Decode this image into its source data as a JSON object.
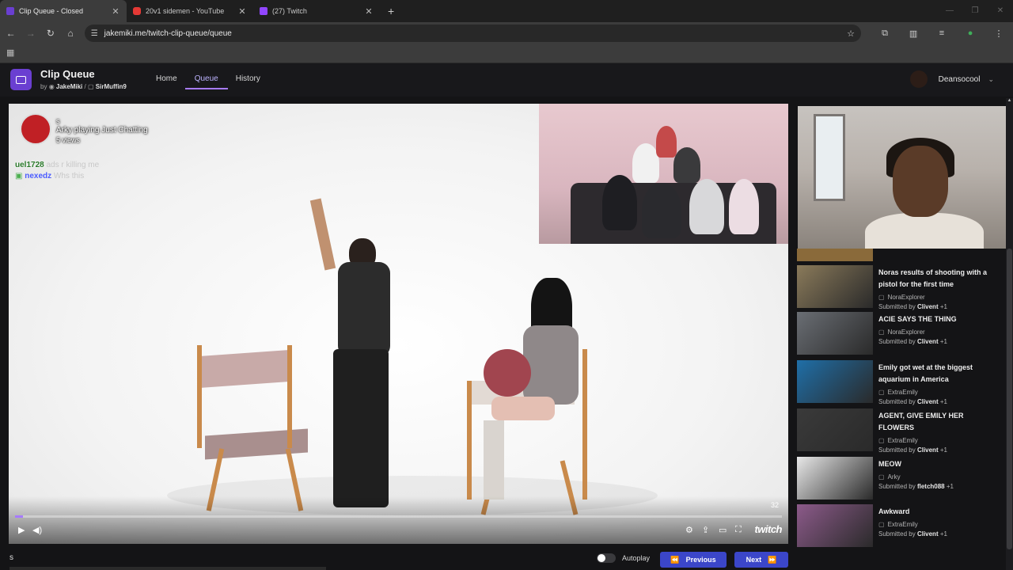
{
  "browser": {
    "tabs": [
      {
        "title": "Clip Queue - Closed",
        "color": "#6a3fd1",
        "active": true
      },
      {
        "title": "20v1 sidemen - YouTube",
        "color": "#e53935",
        "active": false
      },
      {
        "title": "(27) Twitch",
        "color": "#9146ff",
        "active": false
      }
    ],
    "new_tab": "+",
    "url": "jakemiki.me/twitch-clip-queue/queue"
  },
  "app": {
    "name": "Clip Queue",
    "by": "by",
    "author1": "JakeMiki",
    "separator": "/",
    "author2": "SirMuffin9",
    "nav": [
      "Home",
      "Queue",
      "History"
    ],
    "active_nav": "Queue",
    "username": "Deansocool"
  },
  "player": {
    "clip_title": "s",
    "broadcaster": "Arky",
    "game_prefix": "playing",
    "game": "Just Chatting",
    "views": "5 views",
    "time": "32",
    "progress": 0.01,
    "brand": "twitch",
    "chat": [
      {
        "user": "uel1728",
        "msg": "ads r killing me"
      },
      {
        "user": "nexedz",
        "msg": "Whs this"
      }
    ]
  },
  "queue": [
    {
      "title": "Noras results of shooting with a pistol for the first time",
      "channel": "NoraExplorer",
      "submitted_by": "Submitted by",
      "submitter": "Clivent",
      "extra": "+1",
      "thumb": "#8a7a5a"
    },
    {
      "title": "ACIE SAYS THE THING",
      "channel": "NoraExplorer",
      "submitted_by": "Submitted by",
      "submitter": "Clivent",
      "extra": "+1",
      "thumb": "#6a6e74"
    },
    {
      "title": "Emily got wet at the biggest aquarium in America",
      "channel": "ExtraEmily",
      "submitted_by": "Submitted by",
      "submitter": "Clivent",
      "extra": "+1",
      "thumb": "#1f6fa8"
    },
    {
      "title": "AGENT, GIVE EMILY HER FLOWERS",
      "channel": "ExtraEmily",
      "submitted_by": "Submitted by",
      "submitter": "Clivent",
      "extra": "+1",
      "thumb": "#3a3a3a"
    },
    {
      "title": "MEOW",
      "channel": "Arky",
      "submitted_by": "Submitted by",
      "submitter": "fletch088",
      "extra": "+1",
      "thumb": "#e8e8e8"
    },
    {
      "title": "Awkward",
      "channel": "ExtraEmily",
      "submitted_by": "Submitted by",
      "submitter": "Clivent",
      "extra": "+1",
      "thumb": "#8c5a8a"
    }
  ],
  "bottom": {
    "clip_title": "s",
    "autoplay_label": "Autoplay",
    "autoplay_on": false,
    "previous_label": "Previous",
    "next_label": "Next"
  },
  "colors": {
    "accent": "#a77bff",
    "button": "#3b46c9",
    "background": "#141416"
  }
}
